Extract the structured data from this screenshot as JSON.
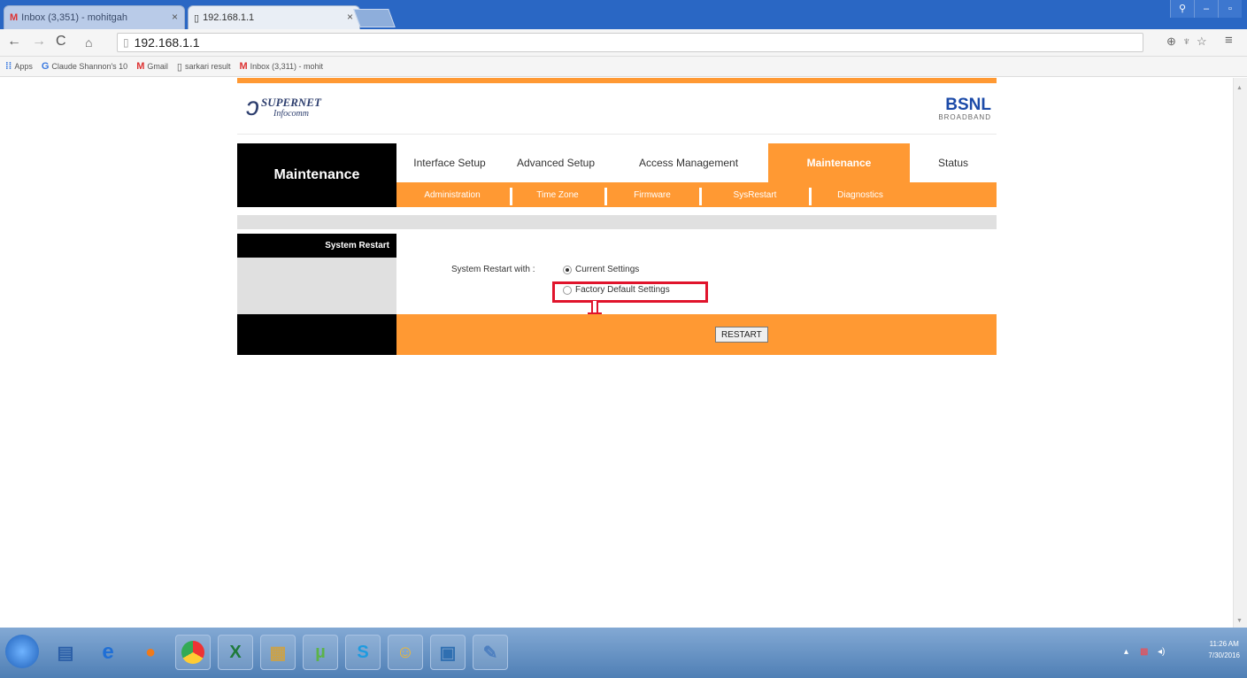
{
  "browser": {
    "tabs": [
      {
        "title": "Inbox (3,351) - mohitgah"
      },
      {
        "title": "192.168.1.1"
      }
    ],
    "url": "192.168.1.1",
    "bookmarks": [
      {
        "label": "Apps"
      },
      {
        "label": "Claude Shannon's 10"
      },
      {
        "label": "Gmail"
      },
      {
        "label": "sarkari result"
      },
      {
        "label": "Inbox (3,311) - mohit"
      }
    ]
  },
  "router": {
    "brand_left": "SUPERNET",
    "brand_left_sub": "Infocomm",
    "brand_right": "BSNL",
    "brand_right_sub": "BROADBAND",
    "section_title": "Maintenance",
    "main_tabs": [
      {
        "label": "Interface Setup"
      },
      {
        "label": "Advanced Setup"
      },
      {
        "label": "Access Management"
      },
      {
        "label": "Maintenance"
      },
      {
        "label": "Status"
      }
    ],
    "sub_tabs": [
      {
        "label": "Administration"
      },
      {
        "label": "Time Zone"
      },
      {
        "label": "Firmware"
      },
      {
        "label": "SysRestart"
      },
      {
        "label": "Diagnostics"
      }
    ],
    "panel_label": "System Restart",
    "restart_with_label": "System Restart with :",
    "options": [
      {
        "label": "Current Settings",
        "checked": true
      },
      {
        "label": "Factory Default Settings",
        "checked": false
      }
    ],
    "restart_button": "RESTART"
  },
  "taskbar": {
    "time": "11:26 AM",
    "date": "7/30/2016"
  }
}
